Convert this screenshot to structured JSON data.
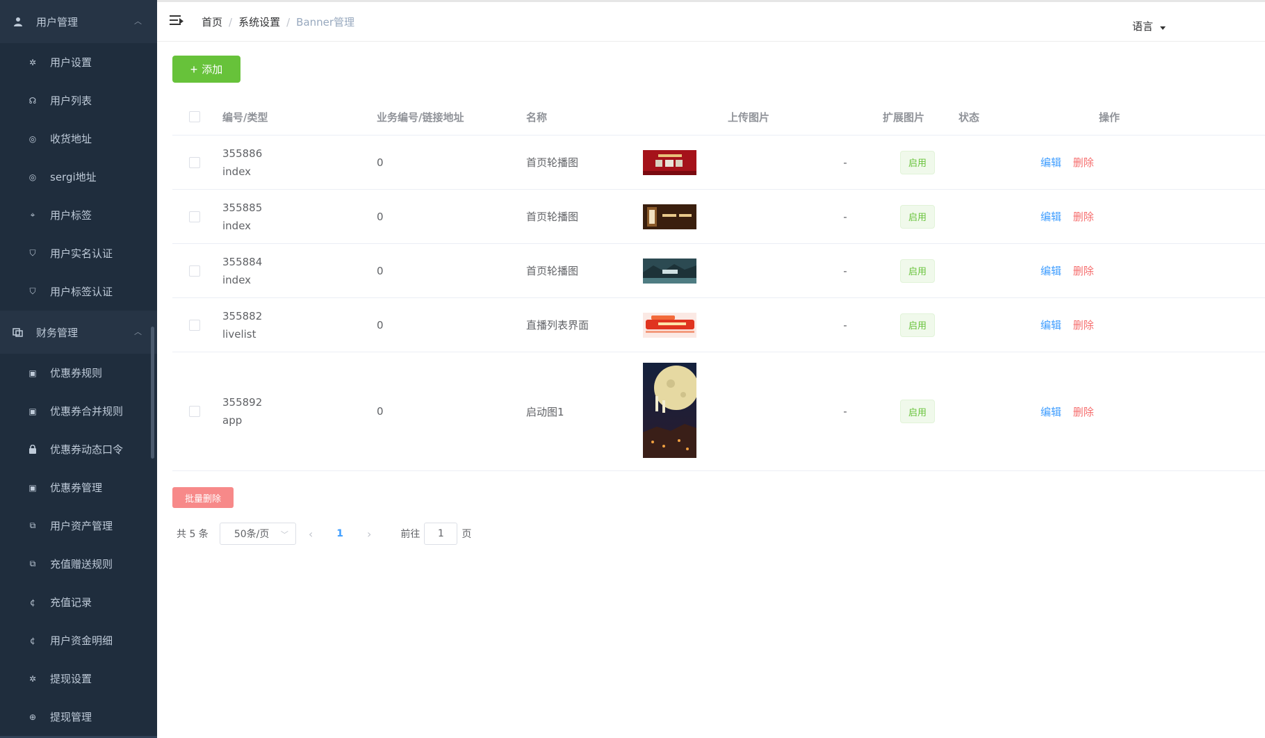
{
  "sidebar": {
    "groups": [
      {
        "label": "用户管理",
        "icon": "user-icon",
        "items": [
          {
            "label": "用户设置",
            "icon": "gear-icon"
          },
          {
            "label": "用户列表",
            "icon": "headset-icon"
          },
          {
            "label": "收货地址",
            "icon": "location-icon"
          },
          {
            "label": "sergi地址",
            "icon": "location-icon"
          },
          {
            "label": "用户标签",
            "icon": "tag-icon"
          },
          {
            "label": "用户实名认证",
            "icon": "shield-icon"
          },
          {
            "label": "用户标签认证",
            "icon": "shield-icon"
          }
        ]
      },
      {
        "label": "财务管理",
        "icon": "coins-icon",
        "items": [
          {
            "label": "优惠券规则",
            "icon": "coupon-icon"
          },
          {
            "label": "优惠券合并规则",
            "icon": "coupon-icon"
          },
          {
            "label": "优惠券动态口令",
            "icon": "lock-icon"
          },
          {
            "label": "优惠券管理",
            "icon": "coupon-icon"
          },
          {
            "label": "用户资产管理",
            "icon": "coins-icon"
          },
          {
            "label": "充值赠送规则",
            "icon": "coins-icon"
          },
          {
            "label": "充值记录",
            "icon": "coin-icon"
          },
          {
            "label": "用户资金明细",
            "icon": "coin-icon"
          },
          {
            "label": "提现设置",
            "icon": "gear-icon"
          },
          {
            "label": "提现管理",
            "icon": "withdraw-icon"
          }
        ]
      }
    ]
  },
  "header": {
    "breadcrumb": [
      "首页",
      "系统设置",
      "Banner管理"
    ],
    "language_label": "语言"
  },
  "toolbar": {
    "add_label": "添加",
    "bulk_delete_label": "批量删除"
  },
  "table": {
    "columns": [
      "编号/类型",
      "业务编号/链接地址",
      "名称",
      "上传图片",
      "扩展图片",
      "状态",
      "操作"
    ],
    "rows": [
      {
        "id": "355886",
        "type": "index",
        "biz": "0",
        "name": "首页轮播图",
        "ext": "-",
        "status": "启用",
        "edit": "编辑",
        "delete": "删除",
        "thumb": "thumb-red-banner"
      },
      {
        "id": "355885",
        "type": "index",
        "biz": "0",
        "name": "首页轮播图",
        "ext": "-",
        "status": "启用",
        "edit": "编辑",
        "delete": "删除",
        "thumb": "thumb-brown-banner"
      },
      {
        "id": "355884",
        "type": "index",
        "biz": "0",
        "name": "首页轮播图",
        "ext": "-",
        "status": "启用",
        "edit": "编辑",
        "delete": "删除",
        "thumb": "thumb-teal-banner"
      },
      {
        "id": "355882",
        "type": "livelist",
        "biz": "0",
        "name": "直播列表界面",
        "ext": "-",
        "status": "启用",
        "edit": "编辑",
        "delete": "删除",
        "thumb": "thumb-live-banner"
      },
      {
        "id": "355892",
        "type": "app",
        "biz": "0",
        "name": "启动图1",
        "ext": "-",
        "status": "启用",
        "edit": "编辑",
        "delete": "删除",
        "thumb": "thumb-moon-splash"
      }
    ]
  },
  "pagination": {
    "total": "共 5 条",
    "page_size": "50条/页",
    "current_page": "1",
    "goto_label": "前往",
    "goto_value": "1",
    "page_suffix": "页"
  },
  "colors": {
    "sidebar_bg": "#304156",
    "submenu_bg": "#1f2d3d",
    "success": "#67c23a",
    "primary": "#409eff",
    "danger": "#f56c6c"
  }
}
